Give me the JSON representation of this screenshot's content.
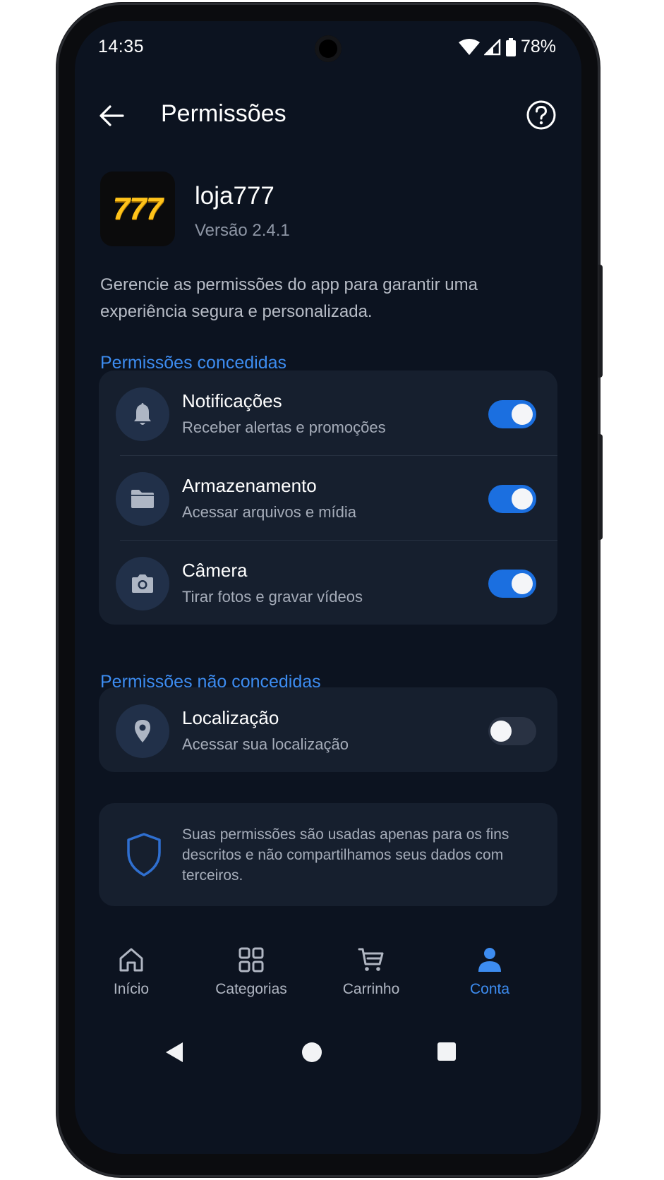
{
  "status_bar": {
    "time": "14:35",
    "battery": "78%"
  },
  "app_bar": {
    "title": "Permissões"
  },
  "app_info": {
    "logo_text": "777",
    "name": "loja777",
    "version": "Versão 2.4.1"
  },
  "description": "Gerencie as permissões do app para garantir uma experiência segura e personalizada.",
  "granted": {
    "title": "Permissões concedidas",
    "items": [
      {
        "title": "Notificações",
        "subtitle": "Receber alertas e promoções",
        "icon": "bell-icon",
        "enabled": true
      },
      {
        "title": "Armazenamento",
        "subtitle": "Acessar arquivos e mídia",
        "icon": "folder-icon",
        "enabled": true
      },
      {
        "title": "Câmera",
        "subtitle": "Tirar fotos e gravar vídeos",
        "icon": "camera-icon",
        "enabled": true
      }
    ]
  },
  "denied": {
    "title": "Permissões não concedidas",
    "items": [
      {
        "title": "Localização",
        "subtitle": "Acessar sua localização",
        "icon": "location-pin-icon",
        "enabled": false
      }
    ]
  },
  "info_card": {
    "icon": "shield-icon",
    "text": "Suas permissões são usadas apenas para os fins descritos e não compartilhamos seus dados com terceiros."
  },
  "bottom_nav": {
    "active": "Conta",
    "items": [
      {
        "label": "Início",
        "icon": "home-icon"
      },
      {
        "label": "Categorias",
        "icon": "grid-icon"
      },
      {
        "label": "Carrinho",
        "icon": "cart-icon"
      },
      {
        "label": "Conta",
        "icon": "person-icon"
      }
    ]
  },
  "colors": {
    "background": "#0c1320",
    "card": "#161f2e",
    "accent": "#3d8cf0",
    "toggle_on": "#1b6fe0",
    "logo_yellow": "#ffc31a"
  }
}
